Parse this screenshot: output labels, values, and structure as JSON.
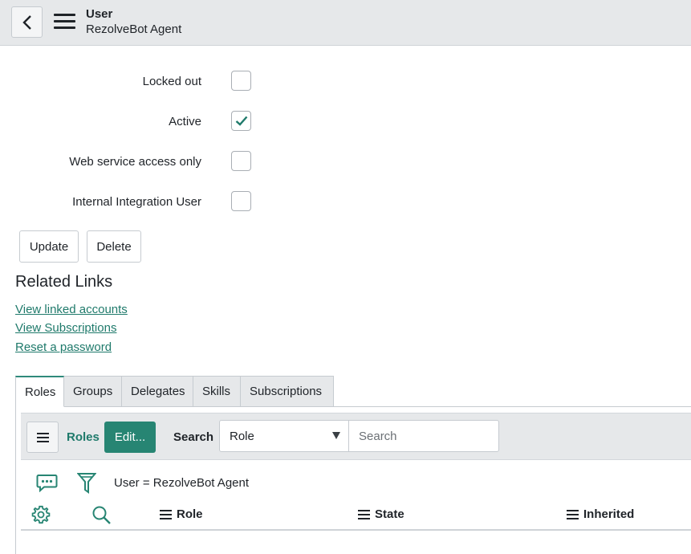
{
  "header": {
    "title": "User",
    "subtitle": "RezolveBot Agent",
    "back_icon": "chevron-left-icon",
    "menu_icon": "hamburger-icon"
  },
  "form": {
    "fields": [
      {
        "label": "Locked out",
        "checked": false
      },
      {
        "label": "Active",
        "checked": true
      },
      {
        "label": "Web service access only",
        "checked": false
      },
      {
        "label": "Internal Integration User",
        "checked": false
      }
    ],
    "update_label": "Update",
    "delete_label": "Delete"
  },
  "related_links": {
    "title": "Related Links",
    "links": [
      "View linked accounts",
      "View Subscriptions",
      "Reset a password"
    ]
  },
  "tabs": [
    "Roles",
    "Groups",
    "Delegates",
    "Skills",
    "Subscriptions"
  ],
  "list": {
    "menu_icon": "list-menu-icon",
    "title": "Roles",
    "edit_label": "Edit...",
    "search_label": "Search",
    "search_field": "Role",
    "search_placeholder": "Search",
    "filter_text": "User = RezolveBot Agent",
    "columns": [
      "Role",
      "State",
      "Inherited"
    ]
  },
  "colors": {
    "accent": "#278573",
    "link": "#1f7a6b",
    "header_bg": "#e6e8ea"
  }
}
